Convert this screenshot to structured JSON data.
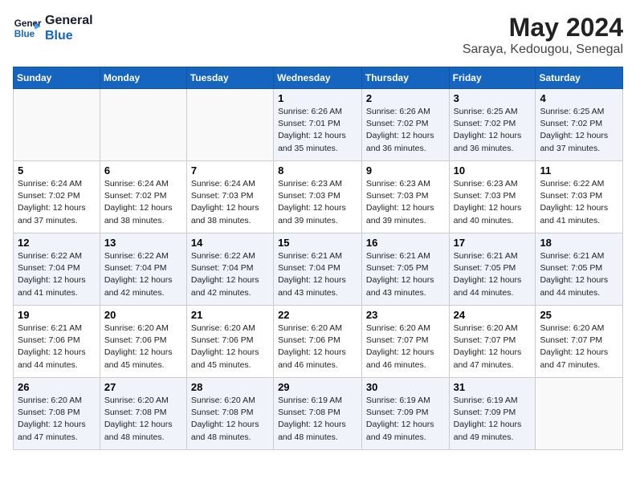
{
  "logo": {
    "line1": "General",
    "line2": "Blue"
  },
  "title": "May 2024",
  "subtitle": "Saraya, Kedougou, Senegal",
  "days_of_week": [
    "Sunday",
    "Monday",
    "Tuesday",
    "Wednesday",
    "Thursday",
    "Friday",
    "Saturday"
  ],
  "weeks": [
    [
      {
        "day": "",
        "info": ""
      },
      {
        "day": "",
        "info": ""
      },
      {
        "day": "",
        "info": ""
      },
      {
        "day": "1",
        "info": "Sunrise: 6:26 AM\nSunset: 7:01 PM\nDaylight: 12 hours\nand 35 minutes."
      },
      {
        "day": "2",
        "info": "Sunrise: 6:26 AM\nSunset: 7:02 PM\nDaylight: 12 hours\nand 36 minutes."
      },
      {
        "day": "3",
        "info": "Sunrise: 6:25 AM\nSunset: 7:02 PM\nDaylight: 12 hours\nand 36 minutes."
      },
      {
        "day": "4",
        "info": "Sunrise: 6:25 AM\nSunset: 7:02 PM\nDaylight: 12 hours\nand 37 minutes."
      }
    ],
    [
      {
        "day": "5",
        "info": "Sunrise: 6:24 AM\nSunset: 7:02 PM\nDaylight: 12 hours\nand 37 minutes."
      },
      {
        "day": "6",
        "info": "Sunrise: 6:24 AM\nSunset: 7:02 PM\nDaylight: 12 hours\nand 38 minutes."
      },
      {
        "day": "7",
        "info": "Sunrise: 6:24 AM\nSunset: 7:03 PM\nDaylight: 12 hours\nand 38 minutes."
      },
      {
        "day": "8",
        "info": "Sunrise: 6:23 AM\nSunset: 7:03 PM\nDaylight: 12 hours\nand 39 minutes."
      },
      {
        "day": "9",
        "info": "Sunrise: 6:23 AM\nSunset: 7:03 PM\nDaylight: 12 hours\nand 39 minutes."
      },
      {
        "day": "10",
        "info": "Sunrise: 6:23 AM\nSunset: 7:03 PM\nDaylight: 12 hours\nand 40 minutes."
      },
      {
        "day": "11",
        "info": "Sunrise: 6:22 AM\nSunset: 7:03 PM\nDaylight: 12 hours\nand 41 minutes."
      }
    ],
    [
      {
        "day": "12",
        "info": "Sunrise: 6:22 AM\nSunset: 7:04 PM\nDaylight: 12 hours\nand 41 minutes."
      },
      {
        "day": "13",
        "info": "Sunrise: 6:22 AM\nSunset: 7:04 PM\nDaylight: 12 hours\nand 42 minutes."
      },
      {
        "day": "14",
        "info": "Sunrise: 6:22 AM\nSunset: 7:04 PM\nDaylight: 12 hours\nand 42 minutes."
      },
      {
        "day": "15",
        "info": "Sunrise: 6:21 AM\nSunset: 7:04 PM\nDaylight: 12 hours\nand 43 minutes."
      },
      {
        "day": "16",
        "info": "Sunrise: 6:21 AM\nSunset: 7:05 PM\nDaylight: 12 hours\nand 43 minutes."
      },
      {
        "day": "17",
        "info": "Sunrise: 6:21 AM\nSunset: 7:05 PM\nDaylight: 12 hours\nand 44 minutes."
      },
      {
        "day": "18",
        "info": "Sunrise: 6:21 AM\nSunset: 7:05 PM\nDaylight: 12 hours\nand 44 minutes."
      }
    ],
    [
      {
        "day": "19",
        "info": "Sunrise: 6:21 AM\nSunset: 7:06 PM\nDaylight: 12 hours\nand 44 minutes."
      },
      {
        "day": "20",
        "info": "Sunrise: 6:20 AM\nSunset: 7:06 PM\nDaylight: 12 hours\nand 45 minutes."
      },
      {
        "day": "21",
        "info": "Sunrise: 6:20 AM\nSunset: 7:06 PM\nDaylight: 12 hours\nand 45 minutes."
      },
      {
        "day": "22",
        "info": "Sunrise: 6:20 AM\nSunset: 7:06 PM\nDaylight: 12 hours\nand 46 minutes."
      },
      {
        "day": "23",
        "info": "Sunrise: 6:20 AM\nSunset: 7:07 PM\nDaylight: 12 hours\nand 46 minutes."
      },
      {
        "day": "24",
        "info": "Sunrise: 6:20 AM\nSunset: 7:07 PM\nDaylight: 12 hours\nand 47 minutes."
      },
      {
        "day": "25",
        "info": "Sunrise: 6:20 AM\nSunset: 7:07 PM\nDaylight: 12 hours\nand 47 minutes."
      }
    ],
    [
      {
        "day": "26",
        "info": "Sunrise: 6:20 AM\nSunset: 7:08 PM\nDaylight: 12 hours\nand 47 minutes."
      },
      {
        "day": "27",
        "info": "Sunrise: 6:20 AM\nSunset: 7:08 PM\nDaylight: 12 hours\nand 48 minutes."
      },
      {
        "day": "28",
        "info": "Sunrise: 6:20 AM\nSunset: 7:08 PM\nDaylight: 12 hours\nand 48 minutes."
      },
      {
        "day": "29",
        "info": "Sunrise: 6:19 AM\nSunset: 7:08 PM\nDaylight: 12 hours\nand 48 minutes."
      },
      {
        "day": "30",
        "info": "Sunrise: 6:19 AM\nSunset: 7:09 PM\nDaylight: 12 hours\nand 49 minutes."
      },
      {
        "day": "31",
        "info": "Sunrise: 6:19 AM\nSunset: 7:09 PM\nDaylight: 12 hours\nand 49 minutes."
      },
      {
        "day": "",
        "info": ""
      }
    ]
  ]
}
